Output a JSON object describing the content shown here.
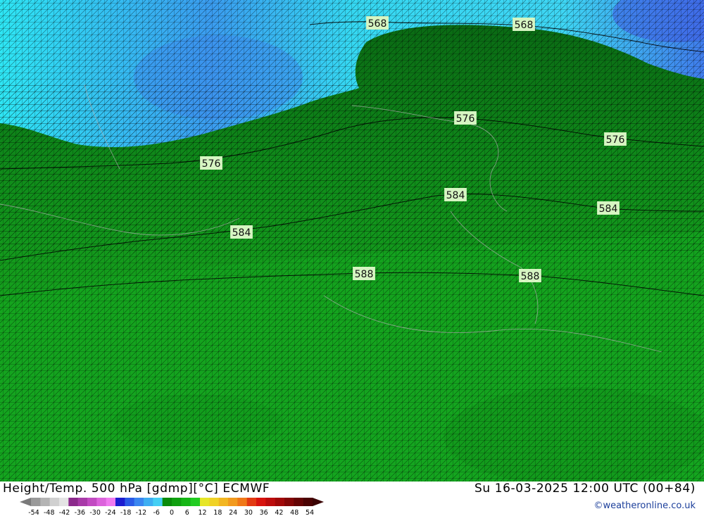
{
  "title": "Height/Temp. 500 hPa [gdmp][°C] ECMWF",
  "datetime": "Su 16-03-2025 12:00 UTC (00+84)",
  "credit": "©weatheronline.co.uk",
  "contour_labels": [
    "568",
    "568",
    "576",
    "576",
    "576",
    "584",
    "584",
    "584",
    "588",
    "588"
  ],
  "colorbar": {
    "ticks": [
      "-54",
      "-48",
      "-42",
      "-36",
      "-30",
      "-24",
      "-18",
      "-12",
      "-6",
      "0",
      "6",
      "12",
      "18",
      "24",
      "30",
      "36",
      "42",
      "48",
      "54"
    ],
    "colors": [
      "#9a9a9a",
      "#b4b4b4",
      "#d0d0d0",
      "#e4e4e4",
      "#8c2a8c",
      "#a83aa8",
      "#c24ac2",
      "#dc62dc",
      "#f07af0",
      "#1c1cd0",
      "#2a5ae6",
      "#3a86f0",
      "#3eaef2",
      "#44cff4",
      "#0a8a0a",
      "#10a010",
      "#16b616",
      "#22cc22",
      "#e6e628",
      "#f0d226",
      "#f2b622",
      "#f29a1e",
      "#f07818",
      "#e23a12",
      "#d8140e",
      "#bc0c0c",
      "#a00808",
      "#820606",
      "#640404",
      "#4a0303"
    ]
  }
}
